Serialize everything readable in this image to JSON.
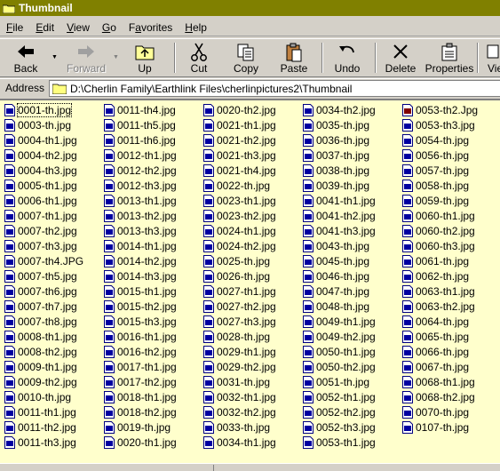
{
  "window": {
    "title": "Thumbnail"
  },
  "menu": [
    {
      "label": "File",
      "key": "F"
    },
    {
      "label": "Edit",
      "key": "E"
    },
    {
      "label": "View",
      "key": "V"
    },
    {
      "label": "Go",
      "key": "G"
    },
    {
      "label": "Favorites",
      "key": "a"
    },
    {
      "label": "Help",
      "key": "H"
    }
  ],
  "toolbar": {
    "back": "Back",
    "forward": "Forward",
    "up": "Up",
    "cut": "Cut",
    "copy": "Copy",
    "paste": "Paste",
    "undo": "Undo",
    "delete": "Delete",
    "properties": "Properties",
    "views": "Vie"
  },
  "address": {
    "label": "Address",
    "path": "D:\\Cherlin Family\\Earthlink Files\\cherlinpictures2\\Thumbnail"
  },
  "files": {
    "col0": [
      "0001-th.jpg",
      "0003-th.jpg",
      "0004-th1.jpg",
      "0004-th2.jpg",
      "0004-th3.jpg",
      "0005-th1.jpg",
      "0006-th1.jpg",
      "0007-th1.jpg",
      "0007-th2.jpg",
      "0007-th3.jpg",
      "0007-th4.JPG",
      "0007-th5.jpg",
      "0007-th6.jpg",
      "0007-th7.jpg",
      "0007-th8.jpg",
      "0008-th1.jpg",
      "0008-th2.jpg",
      "0009-th1.jpg",
      "0009-th2.jpg",
      "0010-th.jpg",
      "0011-th1.jpg",
      "0011-th2.jpg",
      "0011-th3.jpg"
    ],
    "col1": [
      "0011-th4.jpg",
      "0011-th5.jpg",
      "0011-th6.jpg",
      "0012-th1.jpg",
      "0012-th2.jpg",
      "0012-th3.jpg",
      "0013-th1.jpg",
      "0013-th2.jpg",
      "0013-th3.jpg",
      "0014-th1.jpg",
      "0014-th2.jpg",
      "0014-th3.jpg",
      "0015-th1.jpg",
      "0015-th2.jpg",
      "0015-th3.jpg",
      "0016-th1.jpg",
      "0016-th2.jpg",
      "0017-th1.jpg",
      "0017-th2.jpg",
      "0018-th1.jpg",
      "0018-th2.jpg",
      "0019-th.jpg",
      "0020-th1.jpg"
    ],
    "col2": [
      "0020-th2.jpg",
      "0021-th1.jpg",
      "0021-th2.jpg",
      "0021-th3.jpg",
      "0021-th4.jpg",
      "0022-th.jpg",
      "0023-th1.jpg",
      "0023-th2.jpg",
      "0024-th1.jpg",
      "0024-th2.jpg",
      "0025-th.jpg",
      "0026-th.jpg",
      "0027-th1.jpg",
      "0027-th2.jpg",
      "0027-th3.jpg",
      "0028-th.jpg",
      "0029-th1.jpg",
      "0029-th2.jpg",
      "0031-th.jpg",
      "0032-th1.jpg",
      "0032-th2.jpg",
      "0033-th.jpg",
      "0034-th1.jpg"
    ],
    "col3": [
      "0034-th2.jpg",
      "0035-th.jpg",
      "0036-th.jpg",
      "0037-th.jpg",
      "0038-th.jpg",
      "0039-th.jpg",
      "0041-th1.jpg",
      "0041-th2.jpg",
      "0041-th3.jpg",
      "0043-th.jpg",
      "0045-th.jpg",
      "0046-th.jpg",
      "0047-th.jpg",
      "0048-th.jpg",
      "0049-th1.jpg",
      "0049-th2.jpg",
      "0050-th1.jpg",
      "0050-th2.jpg",
      "0051-th.jpg",
      "0052-th1.jpg",
      "0052-th2.jpg",
      "0052-th3.jpg",
      "0053-th1.jpg"
    ],
    "col4": [
      "0053-th2.Jpg",
      "0053-th3.jpg",
      "0054-th.jpg",
      "0056-th.jpg",
      "0057-th.jpg",
      "0058-th.jpg",
      "0059-th.jpg",
      "0060-th1.jpg",
      "0060-th2.jpg",
      "0060-th3.jpg",
      "0061-th.jpg",
      "0062-th.jpg",
      "0063-th1.jpg",
      "0063-th2.jpg",
      "0064-th.jpg",
      "0065-th.jpg",
      "0066-th.jpg",
      "0067-th.jpg",
      "0068-th1.jpg",
      "0068-th2.jpg",
      "0070-th.jpg",
      "0107-th.jpg"
    ]
  }
}
